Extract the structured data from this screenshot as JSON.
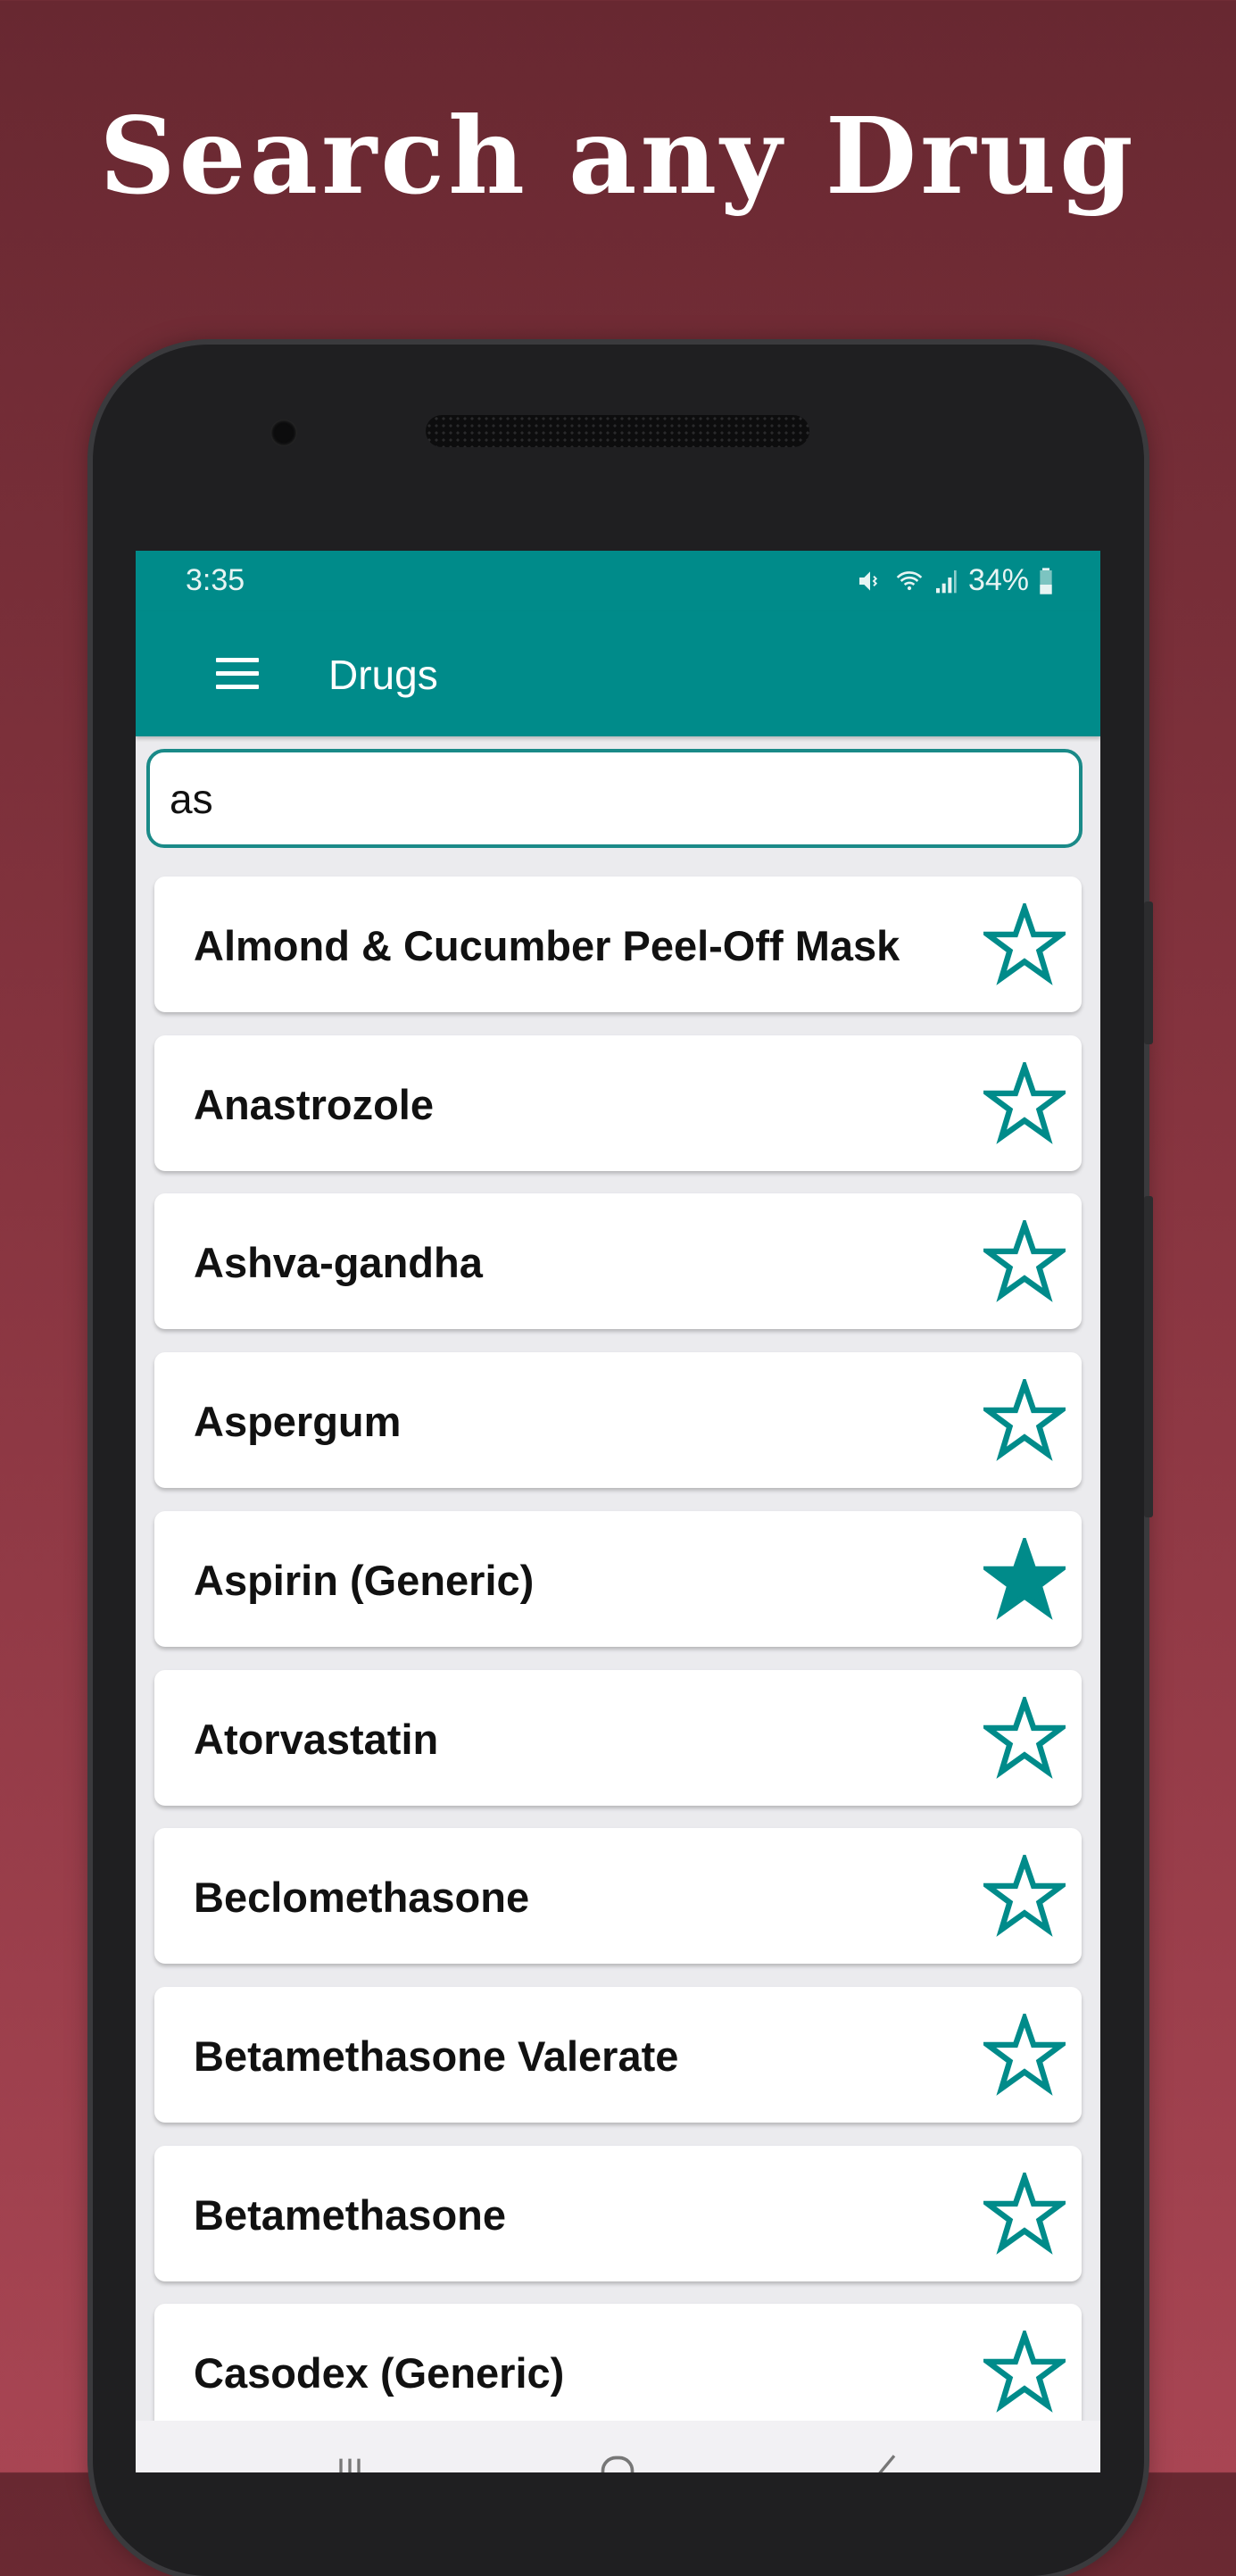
{
  "headline": "Search any Drug",
  "status_bar": {
    "time": "3:35",
    "battery": "34%",
    "icons": [
      "mute-icon",
      "wifi-icon",
      "signal-icon",
      "battery-icon"
    ]
  },
  "toolbar": {
    "title": "Drugs",
    "menu_icon": "hamburger-menu-icon"
  },
  "search": {
    "value": "as"
  },
  "drugs": [
    {
      "name": "Almond & Cucumber Peel-Off Mask",
      "favorite": false
    },
    {
      "name": "Anastrozole",
      "favorite": false
    },
    {
      "name": "Ashva-gandha",
      "favorite": false
    },
    {
      "name": "Aspergum",
      "favorite": false
    },
    {
      "name": "Aspirin (Generic)",
      "favorite": true
    },
    {
      "name": "Atorvastatin",
      "favorite": false
    },
    {
      "name": "Beclomethasone",
      "favorite": false
    },
    {
      "name": "Betamethasone Valerate",
      "favorite": false
    },
    {
      "name": "Betamethasone",
      "favorite": false
    },
    {
      "name": "Casodex (Generic)",
      "favorite": false
    }
  ],
  "colors": {
    "accent": "#008b8a",
    "star": "#008b8a",
    "background_top": "#682831",
    "background_bottom": "#a84553"
  },
  "nav_bar": {
    "icons": [
      "recents-icon",
      "home-icon",
      "back-icon"
    ]
  }
}
